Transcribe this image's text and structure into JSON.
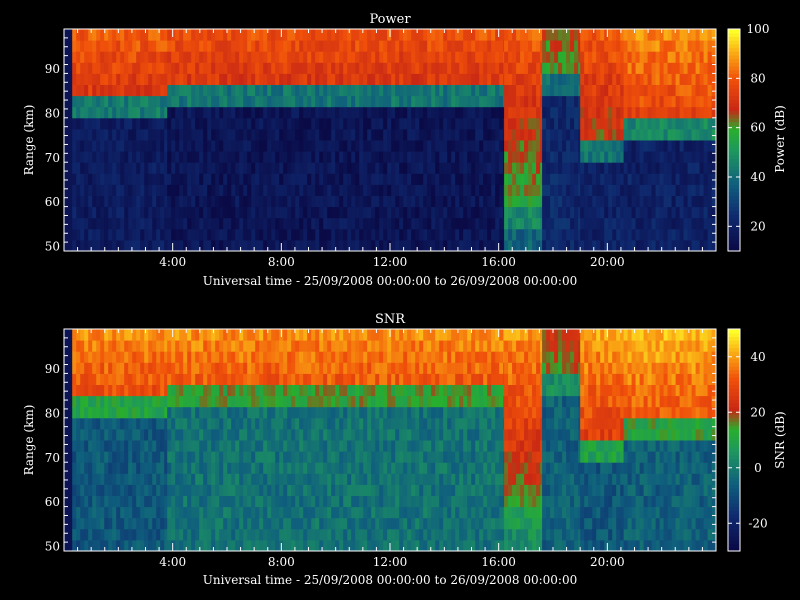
{
  "chart_data": [
    {
      "type": "heatmap",
      "title": "Power",
      "xlabel": "Universal time - 25/09/2008 00:00:00 to 26/09/2008 00:00:00",
      "ylabel": "Range (km)",
      "xlim_hours": [
        0,
        24
      ],
      "x_ticks": [
        "4:00",
        "8:00",
        "12:00",
        "16:00",
        "20:00"
      ],
      "x_tick_hours": [
        4,
        8,
        12,
        16,
        20
      ],
      "ylim": [
        49,
        99
      ],
      "y_ticks": [
        50,
        60,
        70,
        80,
        90
      ],
      "colorbar": {
        "label": "Power (dB)",
        "range": [
          10,
          100
        ],
        "ticks": [
          20,
          40,
          60,
          80,
          100
        ]
      },
      "segments": [
        {
          "from_hour": 0.3,
          "to_hour": 3.8,
          "boundary_km": 80,
          "low_value_db": 18,
          "high_value_db": 70
        },
        {
          "from_hour": 3.8,
          "to_hour": 16.2,
          "boundary_km": 83,
          "low_value_db": 15,
          "high_value_db": 70
        },
        {
          "from_hour": 16.2,
          "to_hour": 17.6,
          "boundary_km": 55,
          "low_value_db": 38,
          "high_value_db": 55
        },
        {
          "from_hour": 17.6,
          "to_hour": 19.0,
          "boundary_km": 85,
          "low_value_db": 22,
          "high_value_db": 58
        },
        {
          "from_hour": 19.0,
          "to_hour": 20.6,
          "boundary_km": 72,
          "low_value_db": 20,
          "high_value_db": 65
        },
        {
          "from_hour": 20.6,
          "to_hour": 24.0,
          "boundary_km": 76,
          "low_value_db": 20,
          "high_value_db": 74
        }
      ]
    },
    {
      "type": "heatmap",
      "title": "SNR",
      "xlabel": "Universal time - 25/09/2008 00:00:00 to 26/09/2008 00:00:00",
      "ylabel": "Range (km)",
      "xlim_hours": [
        0,
        24
      ],
      "x_ticks": [
        "4:00",
        "8:00",
        "12:00",
        "16:00",
        "20:00"
      ],
      "x_tick_hours": [
        4,
        8,
        12,
        16,
        20
      ],
      "ylim": [
        49,
        99
      ],
      "y_ticks": [
        50,
        60,
        70,
        80,
        90
      ],
      "colorbar": {
        "label": "SNR (dB)",
        "range": [
          -30,
          50
        ],
        "ticks": [
          -20,
          0,
          20,
          40
        ]
      },
      "segments": [
        {
          "from_hour": 0.3,
          "to_hour": 3.8,
          "boundary_km": 80,
          "low_value_db": -8,
          "high_value_db": 28
        },
        {
          "from_hour": 3.8,
          "to_hour": 16.2,
          "boundary_km": 83,
          "low_value_db": -2,
          "high_value_db": 30
        },
        {
          "from_hour": 16.2,
          "to_hour": 17.6,
          "boundary_km": 55,
          "low_value_db": 4,
          "high_value_db": 14
        },
        {
          "from_hour": 17.6,
          "to_hour": 19.0,
          "boundary_km": 85,
          "low_value_db": -6,
          "high_value_db": 14
        },
        {
          "from_hour": 19.0,
          "to_hour": 20.6,
          "boundary_km": 72,
          "low_value_db": -8,
          "high_value_db": 26
        },
        {
          "from_hour": 20.6,
          "to_hour": 24.0,
          "boundary_km": 76,
          "low_value_db": -6,
          "high_value_db": 30
        }
      ]
    }
  ]
}
